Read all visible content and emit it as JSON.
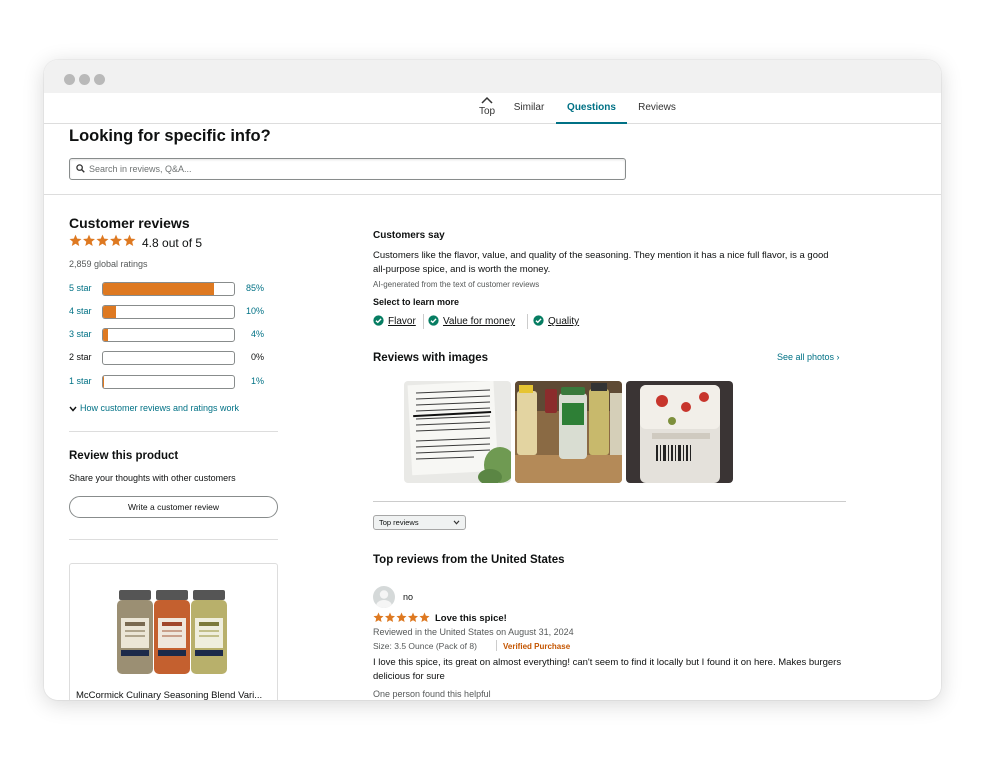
{
  "tabs": {
    "top_label": "Top",
    "items": [
      {
        "label": "Similar",
        "active": false
      },
      {
        "label": "Questions",
        "active": true
      },
      {
        "label": "Reviews",
        "active": false
      }
    ]
  },
  "search": {
    "title": "Looking for specific info?",
    "placeholder": "Search in reviews, Q&A..."
  },
  "customer_reviews": {
    "title": "Customer reviews",
    "average_stars": 4.8,
    "average_text": "4.8 out of 5",
    "global_ratings": "2,859 global ratings",
    "histogram": [
      {
        "label": "5 star",
        "percent": 85,
        "percent_text": "85%",
        "linked": true
      },
      {
        "label": "4 star",
        "percent": 10,
        "percent_text": "10%",
        "linked": true
      },
      {
        "label": "3 star",
        "percent": 4,
        "percent_text": "4%",
        "linked": true
      },
      {
        "label": "2 star",
        "percent": 0,
        "percent_text": "0%",
        "linked": false
      },
      {
        "label": "1 star",
        "percent": 1,
        "percent_text": "1%",
        "linked": true
      }
    ],
    "how_link": "How customer reviews and ratings work"
  },
  "review_product": {
    "title": "Review this product",
    "subtitle": "Share your thoughts with other customers",
    "button_label": "Write a customer review"
  },
  "ad": {
    "title": "McCormick Culinary Seasoning Blend Vari..."
  },
  "customers_say": {
    "title": "Customers say",
    "text": "Customers like the flavor, value, and quality of the seasoning. They mention it has a nice full flavor, is a good all-purpose spice, and is worth the money.",
    "ai_note": "AI-generated from the text of customer reviews",
    "learn_more_title": "Select to learn more",
    "chips": [
      "Flavor",
      "Value for money",
      "Quality"
    ]
  },
  "reviews_with_images": {
    "title": "Reviews with images",
    "see_all": "See all photos ›"
  },
  "sort": {
    "selected": "Top reviews"
  },
  "top_reviews": {
    "title": "Top reviews from the United States",
    "review": {
      "reviewer": "no",
      "stars": 5,
      "headline": "Love this spice!",
      "meta": "Reviewed in the United States on August 31, 2024",
      "size": "Size: 3.5 Ounce (Pack of 8)",
      "verified": "Verified Purchase",
      "body": "I love this spice, its great on almost everything! can't seem to find it locally but I found it on here. Makes burgers delicious for sure",
      "helpful": "One person found this helpful"
    }
  },
  "colors": {
    "accent_link": "#007185",
    "star": "#de7921",
    "verified": "#c45500",
    "check": "#067d62"
  }
}
